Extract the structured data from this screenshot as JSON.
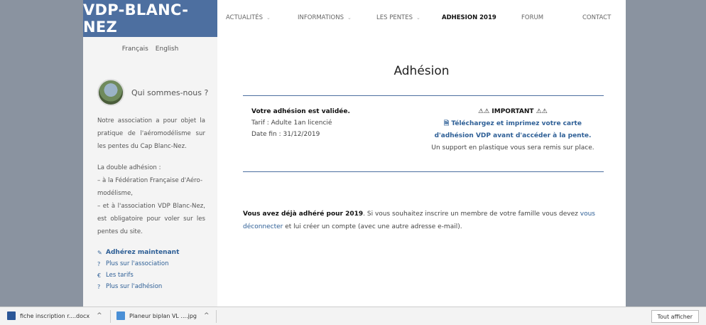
{
  "logo": "VDP-BLANC-NEZ",
  "nav": {
    "items": [
      {
        "label": "ACTUALITÉS",
        "dropdown": true
      },
      {
        "label": "INFORMATIONS",
        "dropdown": true
      },
      {
        "label": "LES PENTES",
        "dropdown": true
      },
      {
        "label": "ADHESION 2019",
        "dropdown": false,
        "active": true
      },
      {
        "label": "FORUM",
        "dropdown": false
      },
      {
        "label": "CONTACT",
        "dropdown": false
      }
    ]
  },
  "sidebar": {
    "languages": [
      "Français",
      "English"
    ],
    "about_title": "Qui sommes-nous ?",
    "about_text": "Notre association a pour objet la pratique de l'aéromodélisme sur les pentes du Cap Blanc-Nez.",
    "double_title": "La double adhésion :",
    "double_line1": "– à la Fédération Française d'Aéro-modélisme,",
    "double_line2": "– et à l'association VDP Blanc-Nez, est obligatoire pour voler sur les pentes du site.",
    "links": [
      {
        "icon": "pencil-icon",
        "glyph": "✎",
        "label": "Adhérez maintenant"
      },
      {
        "icon": "question-icon",
        "glyph": "?",
        "label": "Plus sur l'association"
      },
      {
        "icon": "euro-icon",
        "glyph": "€",
        "label": "Les tarifs"
      },
      {
        "icon": "question-icon",
        "glyph": "?",
        "label": "Plus sur l'adhésion"
      }
    ]
  },
  "main": {
    "title": "Adhésion",
    "status": "Votre adhésion est validée.",
    "tarif": "Tarif : Adulte 1an licencié",
    "date_fin": "Date fin : 31/12/2019",
    "important": "⚠⚠ IMPORTANT ⚠⚠",
    "download_link": "Téléchargez et imprimez votre carte d'adhésion VDP avant d'accéder à la pente.",
    "support": "Un support en plastique vous sera remis sur place.",
    "already_bold": "Vous avez déjà adhéré pour 2019",
    "already_text1": ". Si vous souhaitez inscrire un membre de votre famille vous devez",
    "logout_link": "vous déconnecter",
    "already_text2": " et lui créer un compte (avec une autre adresse e-mail)."
  },
  "downloads": {
    "items": [
      {
        "name": "fiche inscription r....docx",
        "icon": "word-file-icon",
        "color": "#2b5797"
      },
      {
        "name": "Planeur biplan VL ....jpg",
        "icon": "image-file-icon",
        "color": "#4a8fd6"
      }
    ],
    "show_all": "Tout afficher"
  }
}
